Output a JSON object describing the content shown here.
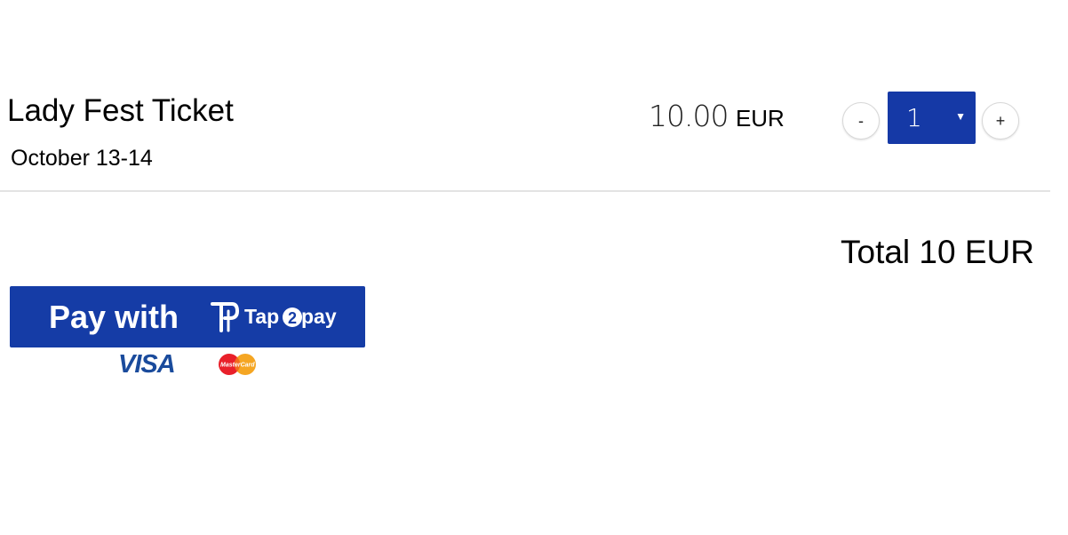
{
  "ticket": {
    "name": "Lady Fest Ticket",
    "date": "October 13-14",
    "price_amount": "10.00",
    "price_currency": "EUR"
  },
  "quantity": {
    "decrement_label": "-",
    "increment_label": "+",
    "selected_value": "1",
    "dropdown_icon": "triangle-down-icon"
  },
  "summary": {
    "total_text": "Total 10 EUR"
  },
  "payment": {
    "button_label": "Pay with",
    "brand_logo_text": "Tap2pay",
    "card_brands": [
      "VISA",
      "MasterCard"
    ],
    "button_color": "#153ca6"
  }
}
